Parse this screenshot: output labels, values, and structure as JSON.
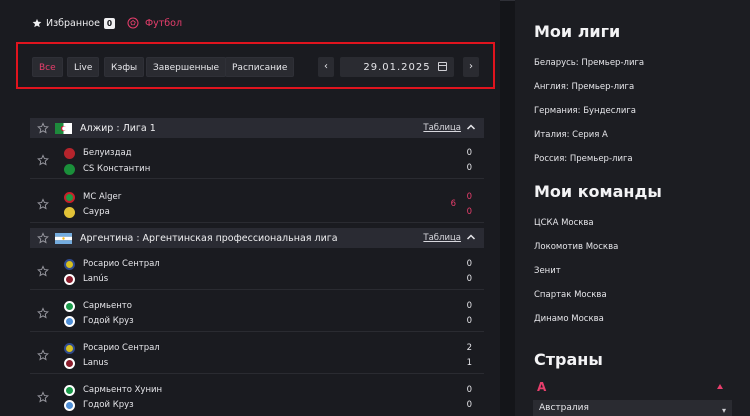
{
  "header": {
    "favorites_label": "Избранное",
    "favorites_count": "0",
    "sport_label": "Футбол"
  },
  "filters": {
    "buttons": [
      "Все",
      "Live",
      "Кэфы",
      "Завершенные",
      "Расписание"
    ],
    "active_index": 0,
    "date_value": "29.01.2025",
    "prev_label": "‹",
    "next_label": "›"
  },
  "leagues": [
    {
      "name": "Алжир :  Лига 1",
      "table_label": "Таблица",
      "matches": [
        {
          "home": "Белуиздад",
          "away": "CS Константин",
          "home_score": "0",
          "away_score": "0",
          "minute": ""
        },
        {
          "home": "MC Alger",
          "away": "Саура",
          "home_score": "0",
          "away_score": "0",
          "minute": "6"
        }
      ]
    },
    {
      "name": "Аргентина :  Аргентинская профессиональная лига",
      "table_label": "Таблица",
      "matches": [
        {
          "home": "Росарио Сентрал",
          "away": "Lanús",
          "home_score": "0",
          "away_score": "0",
          "minute": ""
        },
        {
          "home": "Сармьенто",
          "away": "Годой Круз",
          "home_score": "0",
          "away_score": "0",
          "minute": ""
        },
        {
          "home": "Росарио Сентрал",
          "away": "Lanus",
          "home_score": "2",
          "away_score": "1",
          "minute": ""
        },
        {
          "home": "Сармьенто Хунин",
          "away": "Годой Круз",
          "home_score": "0",
          "away_score": "0",
          "minute": ""
        }
      ]
    }
  ],
  "sidebar": {
    "my_leagues_title": "Мои лиги",
    "my_leagues": [
      "Беларусь: Премьер-лига",
      "Англия: Премьер-лига",
      "Германия: Бундеслига",
      "Италия: Серия А",
      "Россия: Премьер-лига"
    ],
    "my_teams_title": "Мои команды",
    "my_teams": [
      "ЦСКА Москва",
      "Локомотив Москва",
      "Зенит",
      "Спартак Москва",
      "Динамо Москва"
    ],
    "countries_title": "Страны",
    "letter": "А",
    "first_country": "Австралия"
  },
  "colors": {
    "accent": "#e83e6c",
    "highlight_border": "#e0141e",
    "background": "#141519",
    "panel": "#1a1b20"
  }
}
